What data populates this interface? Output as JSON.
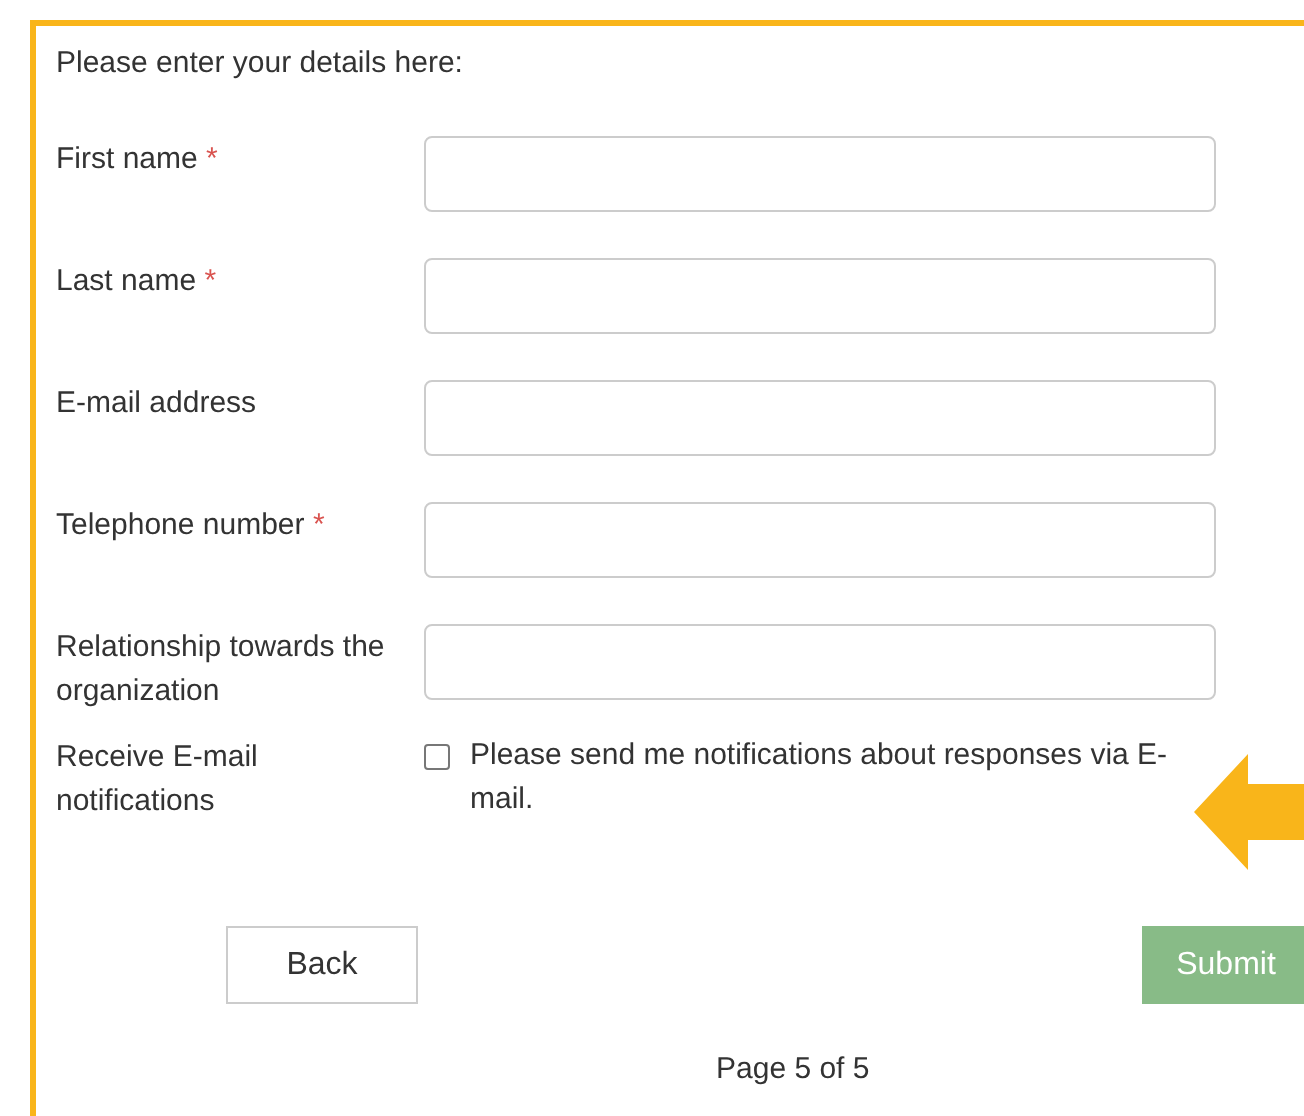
{
  "intro": "Please enter your details here:",
  "fields": [
    {
      "kind": "text",
      "label": "First name",
      "required_mark": "*"
    },
    {
      "kind": "text",
      "label": "Last name",
      "required_mark": "*"
    },
    {
      "kind": "text",
      "label": "E-mail address"
    },
    {
      "kind": "text",
      "label": "Telephone number",
      "required_mark": "*"
    },
    {
      "kind": "text",
      "label": "Relationship towards the organization"
    },
    {
      "kind": "checkbox",
      "label": "Receive E-mail notifications",
      "option": "Please send me notifications about responses via E-mail.",
      "checked": false
    }
  ],
  "buttons": [
    {
      "kind": "back",
      "label": "Back",
      "disabled": false
    },
    {
      "kind": "submit",
      "label": "Submit",
      "disabled": true
    }
  ],
  "page_indicator": "Page 5 of 5"
}
